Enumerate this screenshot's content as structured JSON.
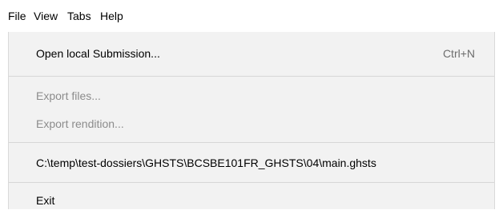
{
  "menubar": {
    "items": [
      {
        "label": "File"
      },
      {
        "label": "View"
      },
      {
        "label": "Tabs"
      },
      {
        "label": "Help"
      }
    ]
  },
  "file_menu": {
    "open_local": {
      "label": "Open local Submission...",
      "shortcut": "Ctrl+N",
      "enabled": true
    },
    "export_files": {
      "label": "Export files...",
      "enabled": false
    },
    "export_rendition": {
      "label": "Export rendition...",
      "enabled": false
    },
    "recent_file": {
      "label": "C:\\temp\\test-dossiers\\GHSTS\\BCSBE101FR_GHSTS\\04\\main.ghsts",
      "enabled": true
    },
    "exit": {
      "label": "Exit",
      "enabled": true
    }
  }
}
